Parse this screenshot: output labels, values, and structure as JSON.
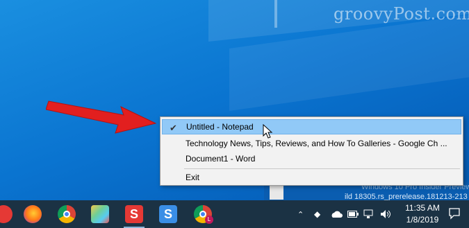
{
  "watermark": "groovyPost.com",
  "menu": {
    "items": [
      {
        "label": "Untitled - Notepad",
        "checked": true,
        "highlighted": true
      },
      {
        "label": "Technology News, Tips, Reviews, and How To Galleries - Google Ch ..."
      },
      {
        "label": "Document1 - Word"
      }
    ],
    "exit_label": "Exit"
  },
  "background_window": {
    "text_1": "Windows 10 Pro Insider Preview",
    "text_2": "ild 18305.rs_prerelease.181213-213"
  },
  "taskbar": {
    "apps": [
      {
        "name": "app-red-icon",
        "color": "#e53935"
      },
      {
        "name": "firefox-icon",
        "color": "#ff7a18"
      },
      {
        "name": "chrome-icon",
        "color": "#4caf50"
      },
      {
        "name": "paint-app-icon",
        "color": "#f2c94c"
      },
      {
        "name": "snagit-icon",
        "color": "#e53935"
      },
      {
        "name": "snagit-editor-icon",
        "color": "#3a8ee6"
      },
      {
        "name": "chrome-profile-icon",
        "color": "#db4437"
      }
    ],
    "clock": {
      "time": "11:35 AM",
      "date": "1/8/2019"
    }
  }
}
